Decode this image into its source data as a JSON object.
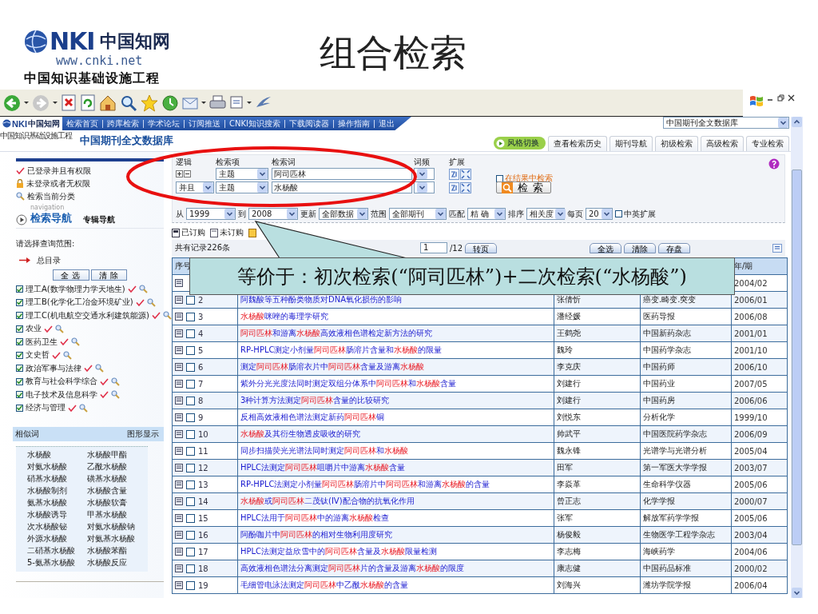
{
  "slide": {
    "title": "组合检索",
    "logo": {
      "brand": "NKI",
      "name": "中国知网",
      "url": "www.cnki.net",
      "tagline": "中国知识基础设施工程"
    }
  },
  "site": {
    "nav_links": [
      "检索首页",
      "跨库检索",
      "学术论坛",
      "订阅推送",
      "CNKI知识搜索",
      "下载阅读器",
      "操作指南",
      "退出"
    ],
    "small_logo": {
      "brand": "NKI",
      "name": "中国知网",
      "tagline": "中国知识基础设施工程"
    },
    "database_select": "中国期刊全文数据库",
    "heading": "中国期刊全文数据库",
    "tabs": [
      {
        "label": "风格切换",
        "kind": "toggle"
      },
      {
        "label": "查看检索历史",
        "kind": "tab"
      },
      {
        "label": "期刊导航",
        "kind": "tab"
      },
      {
        "label": "初级检索",
        "kind": "tab"
      },
      {
        "label": "高级检索",
        "kind": "tab"
      },
      {
        "label": "专业检索",
        "kind": "tab"
      }
    ]
  },
  "sidebar": {
    "legend": [
      {
        "kind": "check",
        "label": "已登录并且有权限"
      },
      {
        "kind": "lock",
        "label": "未登录或者无权限"
      },
      {
        "kind": "search",
        "label": "检索当前分类"
      }
    ],
    "nav_tabs": [
      {
        "caption": "navigation",
        "label": "检索导航",
        "selected": true
      },
      {
        "label": "专辑导航",
        "selected": false
      }
    ],
    "scope_label": "请选择查询范围:",
    "root": "总目录",
    "buttons": [
      "全 选",
      "清 除"
    ],
    "categories": [
      {
        "label": "理工A(数学物理力学天地生)",
        "checked": true
      },
      {
        "label": "理工B(化学化工冶金环境矿业)",
        "checked": true
      },
      {
        "label": "理工C(机电航空交通水利建筑能源)",
        "checked": true
      },
      {
        "label": "农业",
        "checked": true
      },
      {
        "label": "医药卫生",
        "checked": true
      },
      {
        "label": "文史哲",
        "checked": true
      },
      {
        "label": "政治军事与法律",
        "checked": true
      },
      {
        "label": "教育与社会科学综合",
        "checked": true
      },
      {
        "label": "电子技术及信息科学",
        "checked": true
      },
      {
        "label": "经济与管理",
        "checked": true
      }
    ],
    "similar": {
      "title": "相似词",
      "action": "图形显示",
      "words": [
        "水杨酸",
        "水杨酸甲酯",
        "对氨水杨酸",
        "乙酰水杨酸",
        "硝基水杨酸",
        "磺基水杨酸",
        "水杨酸制剂",
        "水杨酸含量",
        "氨基水杨酸",
        "水杨酸软膏",
        "水杨酸诱导",
        "甲基水杨酸",
        "次水杨酸铋",
        "对氨水杨酸钠",
        "外源水杨酸",
        "对氨基水杨酸",
        "二硝基水杨酸",
        "水杨酸苯酯",
        "5-氨基水杨酸",
        "水杨酸反应"
      ]
    }
  },
  "search": {
    "columns": [
      "逻辑",
      "检索项",
      "检索词",
      "词频",
      "扩展"
    ],
    "rows": [
      {
        "kind": "first",
        "field": "主题",
        "term": "阿司匹林"
      },
      {
        "kind": "next",
        "logic": "并且",
        "field": "主题",
        "term": "水杨酸"
      }
    ],
    "in_results": {
      "label": "在结果中检索",
      "checked": false
    },
    "button": "检 索",
    "filters": [
      {
        "label": "从",
        "value": "1999"
      },
      {
        "label": "到",
        "value": "2008"
      },
      {
        "label": "更新",
        "value": "全部数据"
      },
      {
        "label": "范围",
        "value": "全部期刊"
      },
      {
        "label": "匹配",
        "value": "精 确"
      },
      {
        "label": "排序",
        "value": "相关度"
      },
      {
        "label": "每页",
        "value": "20"
      }
    ],
    "cn_en": {
      "label": "中英扩展",
      "checked": false
    }
  },
  "legend2": [
    "已订购",
    "未订购"
  ],
  "results": {
    "total": "共有记录226条",
    "page": "1",
    "pages": "/12",
    "go": "转页",
    "actions": [
      "全选",
      "清除",
      "存盘"
    ],
    "index_heading": "序号",
    "date_heading": "年/期",
    "rows": [
      {
        "date": "2004/02"
      },
      {
        "number": "2",
        "checked": false,
        "title": [
          {
            "text": "阿魏酸等五种酚类物质对DNA氧化损伤的影响",
            "hit": false
          }
        ],
        "author": "张倩忻",
        "journal": "癌变.畸变.突变",
        "date": "2006/01"
      },
      {
        "number": "3",
        "checked": false,
        "title": [
          {
            "text": "水杨酸",
            "hit": true
          },
          {
            "text": "咪唑的毒理学研究",
            "hit": false
          }
        ],
        "author": "潘经媛",
        "journal": "医药导报",
        "date": "2006/08"
      },
      {
        "number": "4",
        "checked": false,
        "title": [
          {
            "text": "阿司匹林",
            "hit": true
          },
          {
            "text": "和游离",
            "hit": false
          },
          {
            "text": "水杨酸",
            "hit": true
          },
          {
            "text": "高效液相色谱检定新方法的研究",
            "hit": false
          }
        ],
        "author": "王鹤尧",
        "journal": "中国新药杂志",
        "date": "2001/01"
      },
      {
        "number": "5",
        "checked": false,
        "title": [
          {
            "text": "RP-HPLC测定小剂量",
            "hit": false
          },
          {
            "text": "阿司匹林",
            "hit": true
          },
          {
            "text": "肠溶片含量和",
            "hit": false
          },
          {
            "text": "水杨酸",
            "hit": true
          },
          {
            "text": "的限量",
            "hit": false
          }
        ],
        "author": "魏玲",
        "journal": "中国药学杂志",
        "date": "2001/10"
      },
      {
        "number": "6",
        "checked": false,
        "title": [
          {
            "text": "测定",
            "hit": false
          },
          {
            "text": "阿司匹林",
            "hit": true
          },
          {
            "text": "肠溶衣片中",
            "hit": false
          },
          {
            "text": "阿司匹林",
            "hit": true
          },
          {
            "text": "含量及游离",
            "hit": false
          },
          {
            "text": "水杨酸",
            "hit": true
          }
        ],
        "author": "李克庆",
        "journal": "中国药师",
        "date": "2006/10"
      },
      {
        "number": "7",
        "checked": false,
        "title": [
          {
            "text": "紫外分光光度法同时测定双组分体系中",
            "hit": false
          },
          {
            "text": "阿司匹林",
            "hit": true
          },
          {
            "text": "和",
            "hit": false
          },
          {
            "text": "水杨酸",
            "hit": true
          },
          {
            "text": "含量",
            "hit": false
          }
        ],
        "author": "刘建行",
        "journal": "中国药业",
        "date": "2007/05"
      },
      {
        "number": "8",
        "checked": false,
        "title": [
          {
            "text": "3种计算方法测定",
            "hit": false
          },
          {
            "text": "阿司匹林",
            "hit": true
          },
          {
            "text": "含量的比较研究",
            "hit": false
          }
        ],
        "author": "刘建行",
        "journal": "中国药房",
        "date": "2006/06"
      },
      {
        "number": "9",
        "checked": false,
        "title": [
          {
            "text": "反相高效液相色谱法测定新药",
            "hit": false
          },
          {
            "text": "阿司匹林",
            "hit": true
          },
          {
            "text": "铜",
            "hit": false
          }
        ],
        "author": "刘悦东",
        "journal": "分析化学",
        "date": "1999/10"
      },
      {
        "number": "10",
        "checked": false,
        "title": [
          {
            "text": "水杨酸",
            "hit": true
          },
          {
            "text": "及其衍生物透皮吸收的研究",
            "hit": false
          }
        ],
        "author": "帅武平",
        "journal": "中国医院药学杂志",
        "date": "2006/09"
      },
      {
        "number": "11",
        "checked": false,
        "title": [
          {
            "text": "同步扫描荧光光谱法同时测定",
            "hit": false
          },
          {
            "text": "阿司匹林",
            "hit": true
          },
          {
            "text": "和",
            "hit": false
          },
          {
            "text": "水杨酸",
            "hit": true
          }
        ],
        "author": "魏永锋",
        "journal": "光谱学与光谱分析",
        "date": "2005/04"
      },
      {
        "number": "12",
        "checked": false,
        "title": [
          {
            "text": "HPLC法测定",
            "hit": false
          },
          {
            "text": "阿司匹林",
            "hit": true
          },
          {
            "text": "咀嚼片中游离",
            "hit": false
          },
          {
            "text": "水杨酸",
            "hit": true
          },
          {
            "text": "含量",
            "hit": false
          }
        ],
        "author": "田军",
        "journal": "第一军医大学学报",
        "date": "2003/07"
      },
      {
        "number": "13",
        "checked": false,
        "title": [
          {
            "text": "RP-HPLC法测定小剂量",
            "hit": false
          },
          {
            "text": "阿司匹林",
            "hit": true
          },
          {
            "text": "肠溶片中",
            "hit": false
          },
          {
            "text": "阿司匹林",
            "hit": true
          },
          {
            "text": "和游离",
            "hit": false
          },
          {
            "text": "水杨酸",
            "hit": true
          },
          {
            "text": "的含量",
            "hit": false
          }
        ],
        "author": "李焱革",
        "journal": "生命科学仪器",
        "date": "2005/06"
      },
      {
        "number": "14",
        "checked": false,
        "title": [
          {
            "text": "水杨酸",
            "hit": true
          },
          {
            "text": "或",
            "hit": false
          },
          {
            "text": "阿司匹林",
            "hit": true
          },
          {
            "text": "二茂钛(IV)配合物的抗氧化作用",
            "hit": false
          }
        ],
        "author": "曾正志",
        "journal": "化学学报",
        "date": "2000/07"
      },
      {
        "number": "15",
        "checked": false,
        "title": [
          {
            "text": "HPLC法用于",
            "hit": false
          },
          {
            "text": "阿司匹林",
            "hit": true
          },
          {
            "text": "中的游离",
            "hit": false
          },
          {
            "text": "水杨酸",
            "hit": true
          },
          {
            "text": "检查",
            "hit": false
          }
        ],
        "author": "张军",
        "journal": "解放军药学学报",
        "date": "2005/06"
      },
      {
        "number": "16",
        "checked": false,
        "title": [
          {
            "text": "阿酚咖片中",
            "hit": false
          },
          {
            "text": "阿司匹林",
            "hit": true
          },
          {
            "text": "的相对生物利用度研究",
            "hit": false
          }
        ],
        "author": "杨俊毅",
        "journal": "生物医学工程学杂志",
        "date": "2003/04"
      },
      {
        "number": "17",
        "checked": false,
        "title": [
          {
            "text": "HPLC法测定益欣雪中的",
            "hit": false
          },
          {
            "text": "阿司匹林",
            "hit": true
          },
          {
            "text": "含量及",
            "hit": false
          },
          {
            "text": "水杨酸",
            "hit": true
          },
          {
            "text": "限量检测",
            "hit": false
          }
        ],
        "author": "李志梅",
        "journal": "海峡药学",
        "date": "2004/06"
      },
      {
        "number": "18",
        "checked": false,
        "title": [
          {
            "text": "高效液相色谱法分离测定",
            "hit": false
          },
          {
            "text": "阿司匹林",
            "hit": true
          },
          {
            "text": "片的含量及游离",
            "hit": false
          },
          {
            "text": "水杨酸",
            "hit": true
          },
          {
            "text": "的限度",
            "hit": false
          }
        ],
        "author": "康志健",
        "journal": "中国药品标准",
        "date": "2000/02"
      },
      {
        "number": "19",
        "checked": false,
        "title": [
          {
            "text": "毛细管电泳法测定",
            "hit": false
          },
          {
            "text": "阿司匹林",
            "hit": true
          },
          {
            "text": "中乙酰",
            "hit": false
          },
          {
            "text": "水杨酸",
            "hit": true
          },
          {
            "text": "的含量",
            "hit": false
          }
        ],
        "author": "刘海兴",
        "journal": "潍坊学院学报",
        "date": "2006/04"
      }
    ]
  },
  "callout": "等价于：初次检索(“阿司匹林”)+二次检索(“水杨酸”)"
}
